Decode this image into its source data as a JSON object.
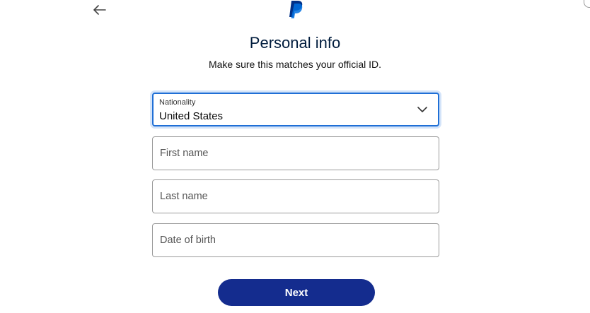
{
  "header": {
    "back_icon": "arrow-left-icon",
    "logo_icon": "paypal-logo-icon",
    "brand_colors": [
      "#003087",
      "#009cde"
    ]
  },
  "main": {
    "title": "Personal info",
    "subtitle": "Make sure this matches your official ID.",
    "nationality": {
      "label": "Nationality",
      "value": "United States",
      "icon": "chevron-down-icon"
    },
    "first_name": {
      "placeholder": "First name",
      "value": ""
    },
    "last_name": {
      "placeholder": "Last name",
      "value": ""
    },
    "date_of_birth": {
      "placeholder": "Date of birth",
      "value": ""
    },
    "next_label": "Next"
  },
  "colors": {
    "primary_button": "#142c8e",
    "focus_border": "#1f6fd6",
    "text": "#001c3d"
  }
}
